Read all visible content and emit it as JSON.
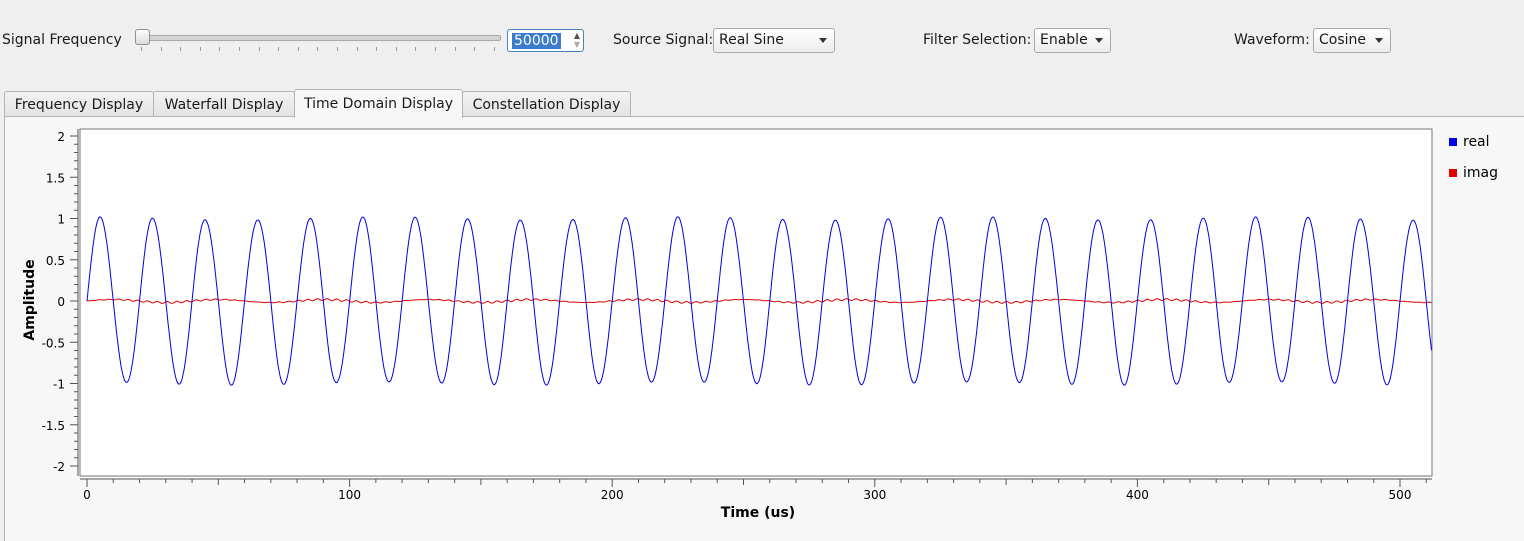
{
  "controls": {
    "signal_frequency_label": "Signal Frequency",
    "signal_frequency_value": "50000",
    "source_signal_label": "Source Signal:",
    "source_signal_value": "Real Sine",
    "filter_selection_label": "Filter Selection:",
    "filter_selection_value": "Enable",
    "waveform_label": "Waveform:",
    "waveform_value": "Cosine"
  },
  "tabs": [
    {
      "label": "Frequency Display"
    },
    {
      "label": "Waterfall Display"
    },
    {
      "label": "Time Domain Display"
    },
    {
      "label": "Constellation Display"
    }
  ],
  "active_tab": "Time Domain Display",
  "chart_data": {
    "type": "line",
    "xlabel": "Time (us)",
    "ylabel": "Amplitude",
    "xlim": [
      0,
      512
    ],
    "ylim": [
      -2,
      2
    ],
    "x_ticks": [
      0,
      100,
      200,
      300,
      400,
      500
    ],
    "y_ticks": [
      2,
      1.5,
      1,
      0.5,
      0,
      -0.5,
      -1,
      -1.5,
      -2
    ],
    "legend_position": "right",
    "series": [
      {
        "name": "real",
        "color": "#0000ff",
        "function": "sine",
        "amplitude": 1.0,
        "period_us": 20,
        "phase_deg": 0
      },
      {
        "name": "imag",
        "color": "#ff0000",
        "function": "noise",
        "amplitude": 0.03
      }
    ]
  }
}
